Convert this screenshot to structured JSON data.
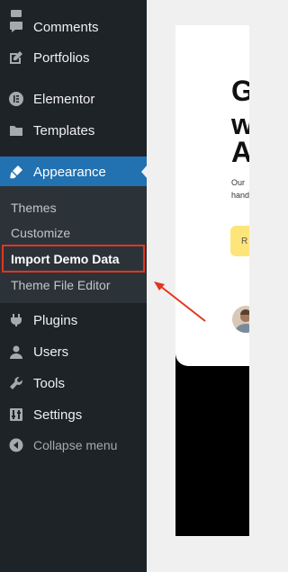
{
  "menu": {
    "items_top": [
      {
        "label": "Comments",
        "icon": "comment-icon"
      },
      {
        "label": "Portfolios",
        "icon": "edit-icon"
      },
      {
        "label": "Elementor",
        "icon": "elementor-icon"
      },
      {
        "label": "Templates",
        "icon": "folder-icon"
      }
    ],
    "active": {
      "label": "Appearance",
      "icon": "paintbrush-icon"
    },
    "submenu": [
      "Themes",
      "Customize",
      "Import Demo Data",
      "Theme File Editor"
    ],
    "items_bottom": [
      {
        "label": "Plugins",
        "icon": "plugin-icon"
      },
      {
        "label": "Users",
        "icon": "users-icon"
      },
      {
        "label": "Tools",
        "icon": "wrench-icon"
      },
      {
        "label": "Settings",
        "icon": "settings-icon"
      }
    ],
    "collapse_label": "Collapse menu"
  },
  "preview": {
    "headline_letters": [
      "G",
      "w",
      "A"
    ],
    "body_lines": [
      "Our",
      "hand"
    ],
    "cta_letter": "R"
  },
  "colors": {
    "sidebar_bg": "#1d2327",
    "active_bg": "#2271b1",
    "submenu_bg": "#2c3338",
    "annotation": "#e2361f",
    "cta": "#fde57a"
  }
}
